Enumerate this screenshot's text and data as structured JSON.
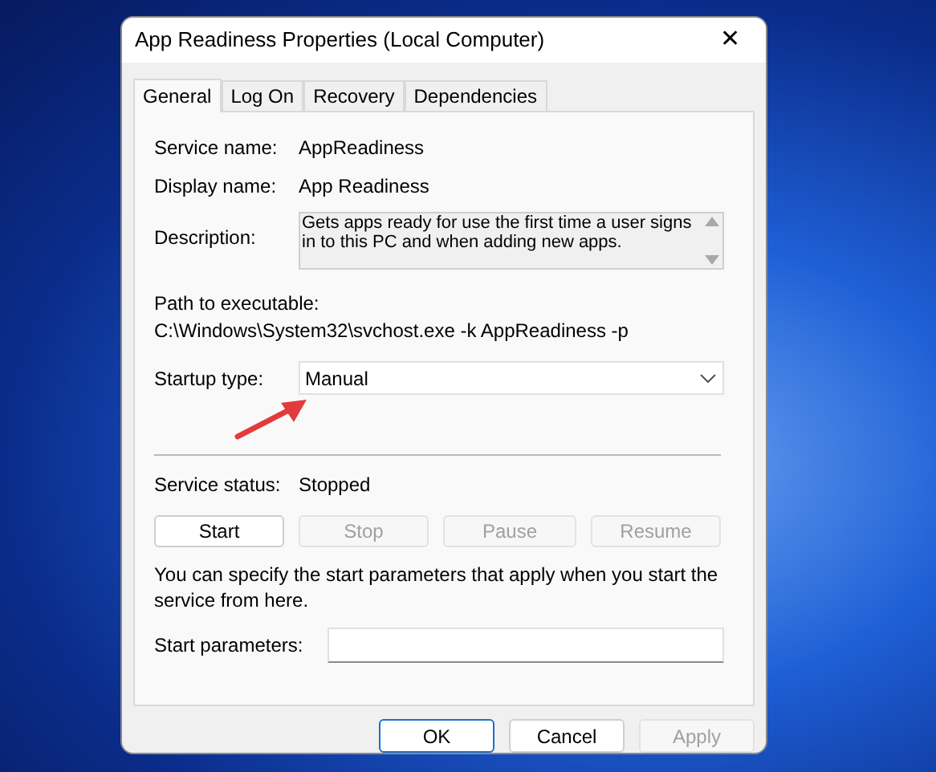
{
  "window": {
    "title": "App Readiness Properties (Local Computer)",
    "close_glyph": "✕"
  },
  "tabs": [
    {
      "label": "General",
      "selected": true
    },
    {
      "label": "Log On",
      "selected": false
    },
    {
      "label": "Recovery",
      "selected": false
    },
    {
      "label": "Dependencies",
      "selected": false
    }
  ],
  "general": {
    "service_name": {
      "label": "Service name:",
      "value": "AppReadiness"
    },
    "display_name": {
      "label": "Display name:",
      "value": "App Readiness"
    },
    "description": {
      "label": "Description:",
      "value": "Gets apps ready for use the first time a user signs in to this PC and when adding new apps."
    },
    "path": {
      "label": "Path to executable:",
      "value": "C:\\Windows\\System32\\svchost.exe -k AppReadiness -p"
    },
    "startup_type": {
      "label": "Startup type:",
      "value": "Manual"
    },
    "service_status": {
      "label": "Service status:",
      "value": "Stopped"
    },
    "service_buttons": [
      {
        "label": "Start",
        "disabled": false
      },
      {
        "label": "Stop",
        "disabled": true
      },
      {
        "label": "Pause",
        "disabled": true
      },
      {
        "label": "Resume",
        "disabled": true
      }
    ],
    "hint": "You can specify the start parameters that apply when you start the service from here.",
    "start_parameters": {
      "label": "Start parameters:"
    }
  },
  "footer_buttons": [
    {
      "label": "OK",
      "disabled": false,
      "default": true
    },
    {
      "label": "Cancel",
      "disabled": false,
      "default": false
    },
    {
      "label": "Apply",
      "disabled": true,
      "default": false
    }
  ]
}
